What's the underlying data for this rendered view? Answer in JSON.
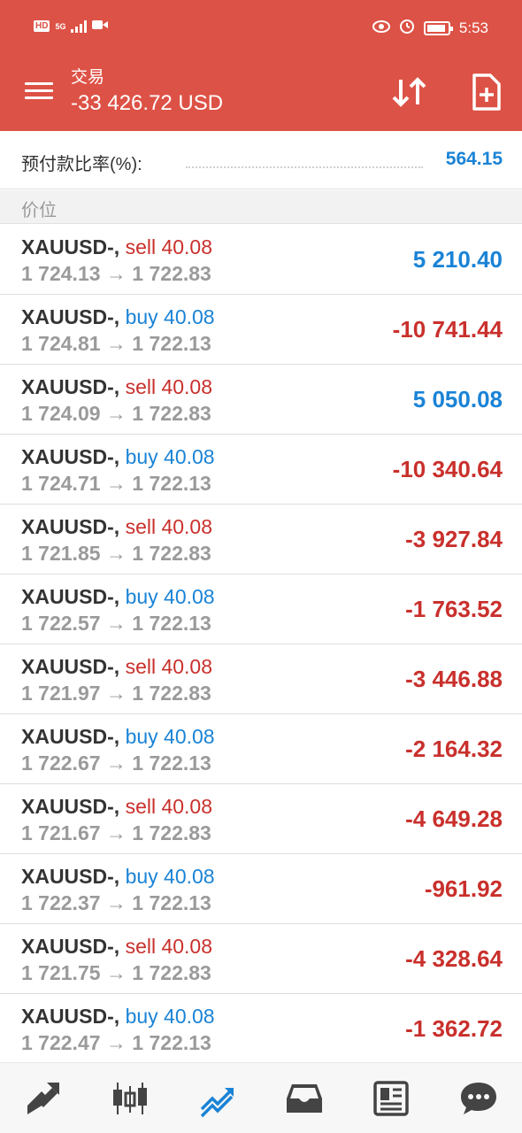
{
  "status_bar": {
    "hd": "HD",
    "network": "5G",
    "time": "5:53"
  },
  "header": {
    "title": "交易",
    "balance": "-33 426.72 USD",
    "icons": [
      "menu-icon",
      "sort-icon",
      "new-order-icon"
    ]
  },
  "margin": {
    "label": "预付款比率(%):",
    "value": "564.15"
  },
  "section": {
    "label": "价位"
  },
  "positions": [
    {
      "symbol": "XAUUSD-,",
      "type": "sell",
      "type_label": "sell 40.08",
      "prices": "1 724.13 → 1 722.83",
      "profit": "5 210.40",
      "sign": "pos"
    },
    {
      "symbol": "XAUUSD-,",
      "type": "buy",
      "type_label": "buy 40.08",
      "prices": "1 724.81 → 1 722.13",
      "profit": "-10 741.44",
      "sign": "neg"
    },
    {
      "symbol": "XAUUSD-,",
      "type": "sell",
      "type_label": "sell 40.08",
      "prices": "1 724.09 → 1 722.83",
      "profit": "5 050.08",
      "sign": "pos"
    },
    {
      "symbol": "XAUUSD-,",
      "type": "buy",
      "type_label": "buy 40.08",
      "prices": "1 724.71 → 1 722.13",
      "profit": "-10 340.64",
      "sign": "neg"
    },
    {
      "symbol": "XAUUSD-,",
      "type": "sell",
      "type_label": "sell 40.08",
      "prices": "1 721.85 → 1 722.83",
      "profit": "-3 927.84",
      "sign": "neg"
    },
    {
      "symbol": "XAUUSD-,",
      "type": "buy",
      "type_label": "buy 40.08",
      "prices": "1 722.57 → 1 722.13",
      "profit": "-1 763.52",
      "sign": "neg"
    },
    {
      "symbol": "XAUUSD-,",
      "type": "sell",
      "type_label": "sell 40.08",
      "prices": "1 721.97 → 1 722.83",
      "profit": "-3 446.88",
      "sign": "neg"
    },
    {
      "symbol": "XAUUSD-,",
      "type": "buy",
      "type_label": "buy 40.08",
      "prices": "1 722.67 → 1 722.13",
      "profit": "-2 164.32",
      "sign": "neg"
    },
    {
      "symbol": "XAUUSD-,",
      "type": "sell",
      "type_label": "sell 40.08",
      "prices": "1 721.67 → 1 722.83",
      "profit": "-4 649.28",
      "sign": "neg"
    },
    {
      "symbol": "XAUUSD-,",
      "type": "buy",
      "type_label": "buy 40.08",
      "prices": "1 722.37 → 1 722.13",
      "profit": "-961.92",
      "sign": "neg"
    },
    {
      "symbol": "XAUUSD-,",
      "type": "sell",
      "type_label": "sell 40.08",
      "prices": "1 721.75 → 1 722.83",
      "profit": "-4 328.64",
      "sign": "neg"
    },
    {
      "symbol": "XAUUSD-,",
      "type": "buy",
      "type_label": "buy 40.08",
      "prices": "1 722.47 → 1 722.13",
      "profit": "-1 362.72",
      "sign": "neg"
    }
  ],
  "bottom_nav": [
    {
      "name": "nav-quotes",
      "icon": "quotes-arrows-icon",
      "active": false
    },
    {
      "name": "nav-chart",
      "icon": "candlestick-icon",
      "active": false
    },
    {
      "name": "nav-trade",
      "icon": "trade-trend-icon",
      "active": true
    },
    {
      "name": "nav-history",
      "icon": "inbox-history-icon",
      "active": false
    },
    {
      "name": "nav-news",
      "icon": "news-icon",
      "active": false
    },
    {
      "name": "nav-messages",
      "icon": "chat-bubble-icon",
      "active": false
    }
  ],
  "colors": {
    "header_bg": "#dd5246",
    "buy_blue": "#1a83d6",
    "sell_red": "#c9302c",
    "muted_grey": "#9a9a9a",
    "nav_active": "#1a83d6",
    "nav_inactive": "#444444"
  }
}
